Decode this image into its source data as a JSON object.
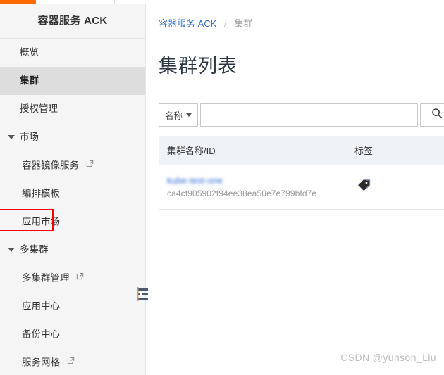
{
  "window": {
    "accent_color": "#ff6a00",
    "watermark": "CSDN @yunson_Liu"
  },
  "sidebar": {
    "title": "容器服务 ACK",
    "items": [
      {
        "label": "概览",
        "type": "item",
        "selected": false
      },
      {
        "label": "集群",
        "type": "item",
        "selected": true
      },
      {
        "label": "授权管理",
        "type": "item",
        "selected": false
      },
      {
        "label": "市场",
        "type": "group",
        "expanded": true
      },
      {
        "label": "容器镜像服务",
        "type": "sub",
        "external": true
      },
      {
        "label": "编排模板",
        "type": "sub",
        "external": false
      },
      {
        "label": "应用市场",
        "type": "sub",
        "external": false,
        "highlighted": true
      },
      {
        "label": "多集群",
        "type": "group",
        "expanded": true
      },
      {
        "label": "多集群管理",
        "type": "sub",
        "external": true
      },
      {
        "label": "应用中心",
        "type": "sub",
        "external": false
      },
      {
        "label": "备份中心",
        "type": "sub",
        "external": false
      },
      {
        "label": "服务网格",
        "type": "sub",
        "external": true
      }
    ],
    "highlight_color": "#fa0000",
    "collapse_handle": "sidebar-collapse-handle"
  },
  "breadcrumb": {
    "root": "容器服务 ACK",
    "separator": "/",
    "current": "集群"
  },
  "page": {
    "title": "集群列表"
  },
  "search": {
    "filter_label": "名称",
    "filter_options": [
      "名称"
    ],
    "input_value": "",
    "input_placeholder": "",
    "button_icon": "search-icon"
  },
  "table": {
    "columns": [
      {
        "key": "name",
        "label": "集群名称/ID"
      },
      {
        "key": "tag",
        "label": "标签"
      }
    ],
    "rows": [
      {
        "name": "",
        "name_redacted": true,
        "id": "ca4cf905902f94ee38ea50e7e799bfd7e",
        "tag_icon": "tag-icon"
      }
    ]
  }
}
